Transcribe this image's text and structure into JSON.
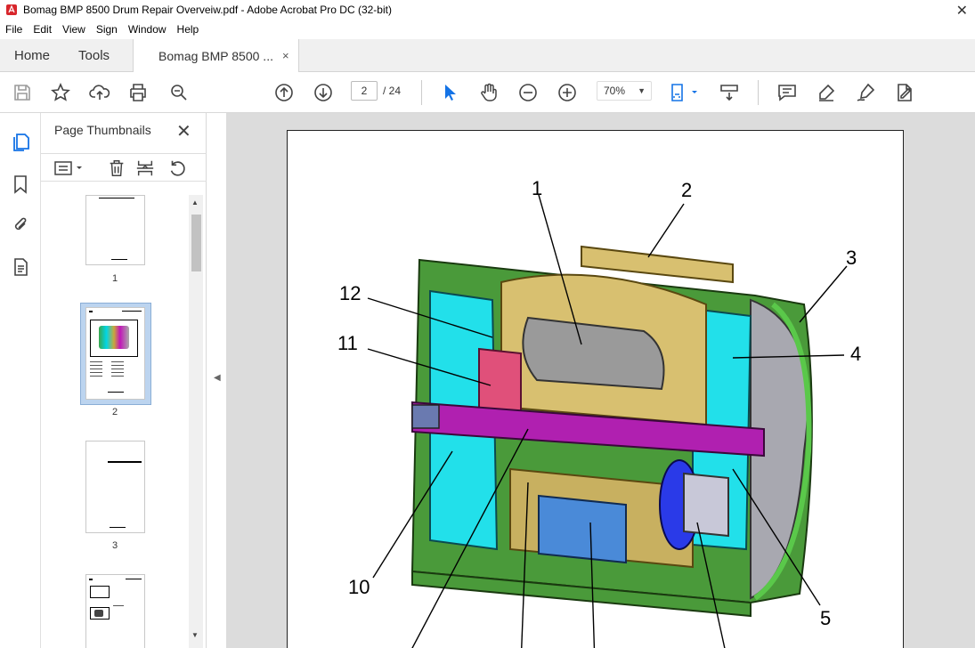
{
  "window": {
    "title": "Bomag BMP 8500 Drum Repair Overveiw.pdf - Adobe Acrobat Pro DC (32-bit)"
  },
  "menu": [
    "File",
    "Edit",
    "View",
    "Sign",
    "Window",
    "Help"
  ],
  "tabs": {
    "home": "Home",
    "tools": "Tools",
    "document": "Bomag BMP 8500 ...",
    "document_close": "×"
  },
  "toolbar": {
    "page_current": "2",
    "page_total": "/ 24",
    "zoom": "70%"
  },
  "panel": {
    "title": "Page Thumbnails",
    "close": "✕",
    "thumbnails": [
      {
        "label": "1",
        "selected": false
      },
      {
        "label": "2",
        "selected": true
      },
      {
        "label": "3",
        "selected": false
      },
      {
        "label": "",
        "selected": false
      }
    ]
  },
  "drawing": {
    "callouts": [
      "1",
      "2",
      "3",
      "4",
      "5",
      "10",
      "11",
      "12"
    ]
  },
  "colors": {
    "accent": "#1473e6",
    "selected_thumb": "#bcd4ef"
  }
}
